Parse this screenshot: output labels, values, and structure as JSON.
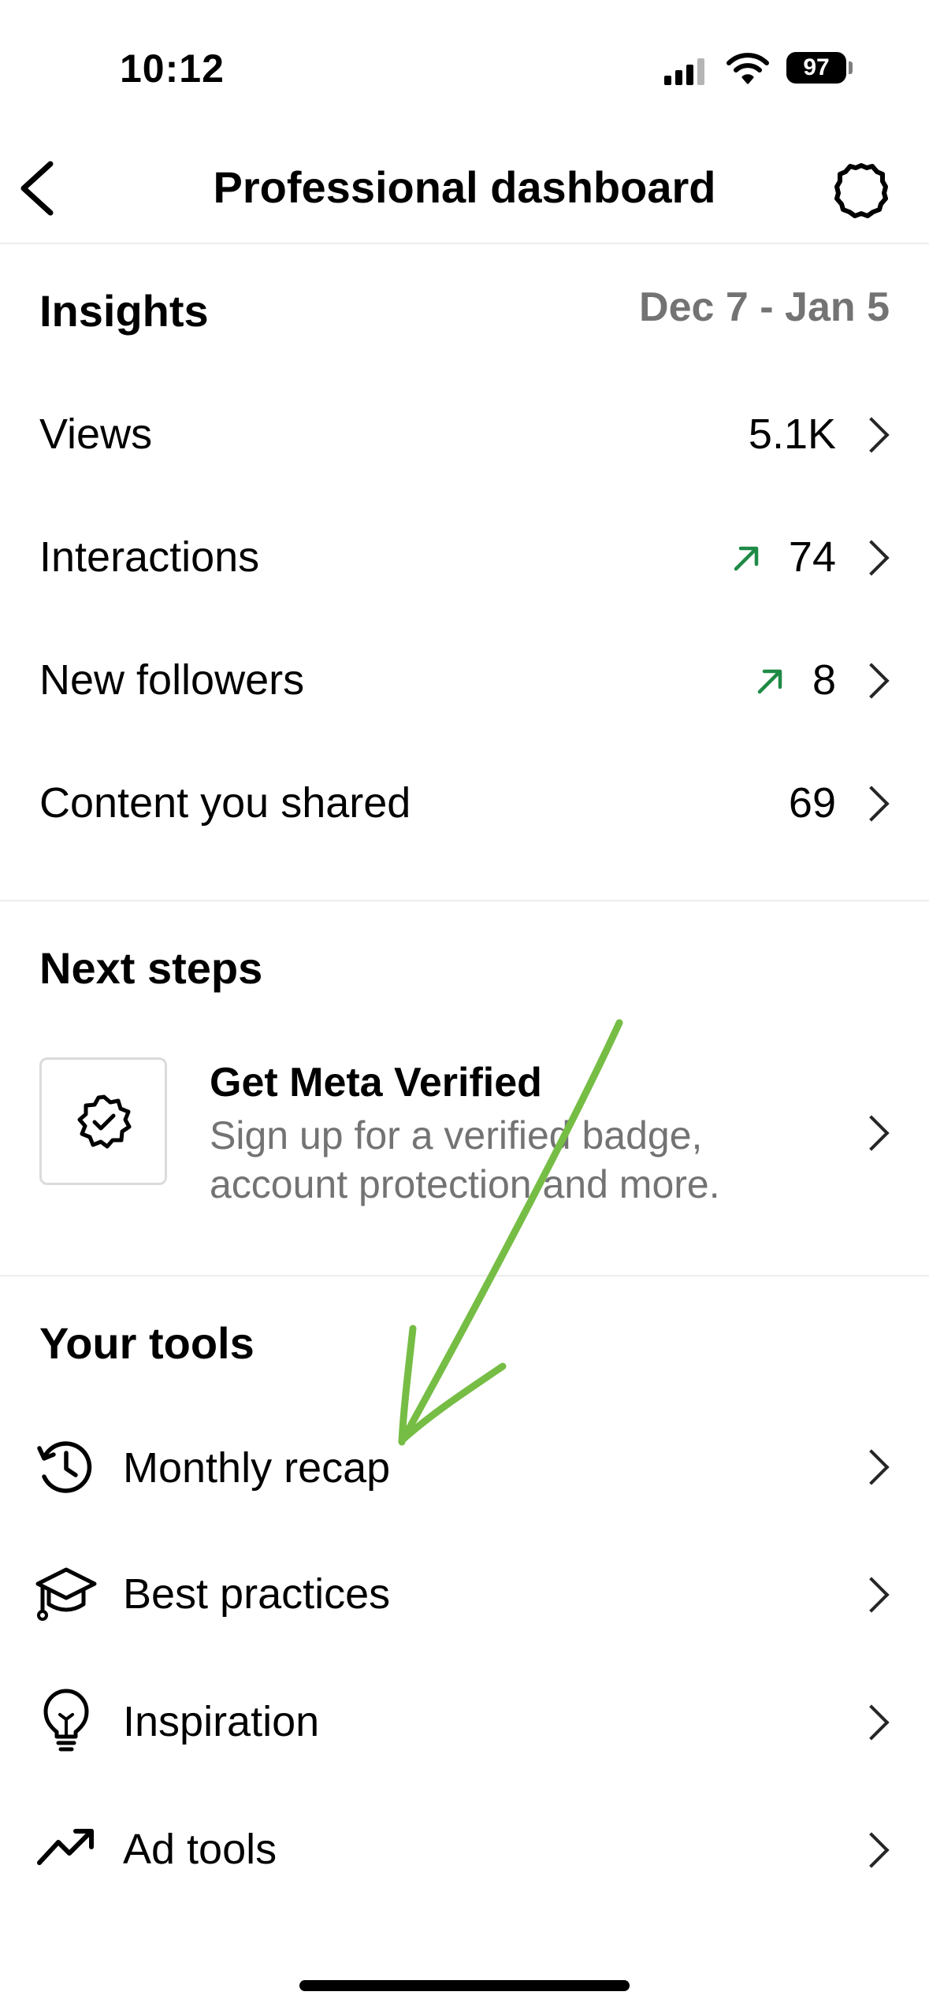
{
  "status_bar": {
    "time": "10:12",
    "battery": "97"
  },
  "nav": {
    "title": "Professional dashboard",
    "back_icon": "chevron-left-icon",
    "settings_icon": "gear-icon"
  },
  "insights": {
    "title": "Insights",
    "date_range": "Dec 7 - Jan 5",
    "rows": [
      {
        "label": "Views",
        "value": "5.1K",
        "trend": ""
      },
      {
        "label": "Interactions",
        "value": "74",
        "trend": "up"
      },
      {
        "label": "New followers",
        "value": "8",
        "trend": "up"
      },
      {
        "label": "Content you shared",
        "value": "69",
        "trend": ""
      }
    ],
    "trend_color": "#1f8a47"
  },
  "next_steps": {
    "title": "Next steps",
    "card": {
      "title": "Get Meta Verified",
      "description": "Sign up for a verified badge, account protection and more.",
      "icon": "verified-badge-icon"
    }
  },
  "tools": {
    "title": "Your tools",
    "items": [
      {
        "label": "Monthly recap",
        "icon": "history-clock-icon"
      },
      {
        "label": "Best practices",
        "icon": "graduation-cap-icon"
      },
      {
        "label": "Inspiration",
        "icon": "lightbulb-icon"
      },
      {
        "label": "Ad tools",
        "icon": "trending-up-icon"
      }
    ]
  },
  "annotation": {
    "arrow_color": "#76bd45"
  }
}
